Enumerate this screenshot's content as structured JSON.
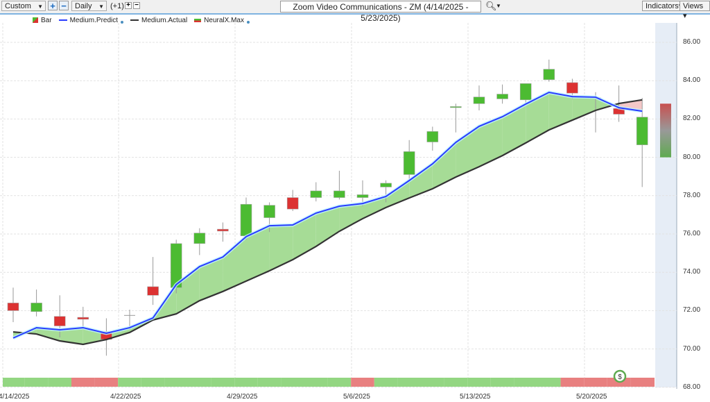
{
  "toolbar": {
    "range": "Custom",
    "interval": "Daily",
    "offset": "(+1)",
    "title": "Zoom Video Communications - ZM (4/14/2025 - 5/23/2025)",
    "indicators": "Indicators",
    "views": "Views"
  },
  "legend": [
    "Bar",
    "Medium.Predict",
    "Medium.Actual",
    "NeuralX.Max"
  ],
  "colors": {
    "up": "#4cbb32",
    "down": "#dc3232",
    "predict": "#2a3cff",
    "actual": "#333333",
    "bandUp": "#a6dc96",
    "bandDown": "#f4c8c8",
    "sigGreen": "#93d682",
    "sigRed": "#e88080"
  },
  "chart_data": {
    "type": "candlestick",
    "ylim": [
      68,
      86
    ],
    "yticks": [
      "86.00",
      "84.00",
      "82.00",
      "80.00",
      "78.00",
      "76.00",
      "74.00",
      "72.00",
      "70.00",
      "68.00"
    ],
    "xticks": [
      {
        "label": "4/14/2025",
        "i": 0
      },
      {
        "label": "4/22/2025",
        "i": 5
      },
      {
        "label": "4/29/2025",
        "i": 10
      },
      {
        "label": "5/6/2025",
        "i": 15
      },
      {
        "label": "5/13/2025",
        "i": 20
      },
      {
        "label": "5/20/2025",
        "i": 25
      }
    ],
    "ohlc": [
      [
        72.4,
        73.2,
        71.4,
        72.0
      ],
      [
        71.95,
        73.1,
        71.7,
        72.4
      ],
      [
        71.7,
        72.8,
        70.6,
        71.2
      ],
      [
        71.65,
        72.2,
        71.0,
        71.55
      ],
      [
        70.9,
        71.6,
        69.65,
        70.5
      ],
      [
        71.75,
        72.05,
        71.0,
        71.75
      ],
      [
        73.25,
        74.8,
        72.3,
        72.8
      ],
      [
        73.2,
        75.7,
        72.9,
        75.5
      ],
      [
        75.5,
        76.3,
        74.9,
        76.05
      ],
      [
        76.25,
        76.6,
        75.6,
        76.15
      ],
      [
        75.9,
        77.9,
        75.7,
        77.55
      ],
      [
        76.85,
        77.65,
        76.1,
        77.5
      ],
      [
        77.9,
        78.3,
        77.2,
        77.3
      ],
      [
        77.9,
        78.7,
        77.7,
        78.25
      ],
      [
        77.9,
        79.3,
        77.8,
        78.25
      ],
      [
        77.9,
        78.8,
        77.45,
        78.05
      ],
      [
        78.45,
        78.8,
        77.65,
        78.65
      ],
      [
        79.1,
        80.9,
        78.7,
        80.3
      ],
      [
        80.8,
        81.6,
        80.35,
        81.35
      ],
      [
        82.6,
        82.8,
        81.3,
        82.65
      ],
      [
        82.8,
        83.75,
        82.45,
        83.15
      ],
      [
        83.05,
        83.8,
        82.8,
        83.3
      ],
      [
        83.0,
        83.85,
        82.8,
        83.85
      ],
      [
        84.05,
        85.1,
        83.95,
        84.6
      ],
      [
        83.9,
        84.1,
        83.05,
        83.35
      ],
      [
        83.1,
        83.4,
        81.3,
        83.1
      ],
      [
        82.55,
        83.75,
        81.85,
        82.25
      ],
      [
        80.65,
        83.1,
        78.45,
        82.1
      ]
    ],
    "predict": [
      70.57,
      71.11,
      71.0,
      71.11,
      70.82,
      71.11,
      71.62,
      73.36,
      74.3,
      74.8,
      75.86,
      76.43,
      76.47,
      77.09,
      77.45,
      77.59,
      77.96,
      78.79,
      79.66,
      80.78,
      81.62,
      82.12,
      82.78,
      83.39,
      83.17,
      83.14,
      82.59,
      82.41
    ],
    "actual": [
      70.89,
      70.78,
      70.42,
      70.24,
      70.49,
      70.86,
      71.51,
      71.83,
      72.52,
      73.0,
      73.54,
      74.08,
      74.66,
      75.35,
      76.14,
      76.8,
      77.38,
      77.88,
      78.36,
      78.97,
      79.51,
      80.09,
      80.75,
      81.43,
      81.94,
      82.45,
      82.81,
      83.0
    ],
    "signals": [
      "g",
      "g",
      "g",
      "r",
      "r",
      "g",
      "g",
      "g",
      "g",
      "g",
      "g",
      "g",
      "g",
      "g",
      "g",
      "r",
      "g",
      "g",
      "g",
      "g",
      "g",
      "g",
      "g",
      "g",
      "r",
      "r",
      "r",
      "r"
    ],
    "forecast_range": [
      80.0,
      82.8
    ]
  },
  "badge": "$"
}
